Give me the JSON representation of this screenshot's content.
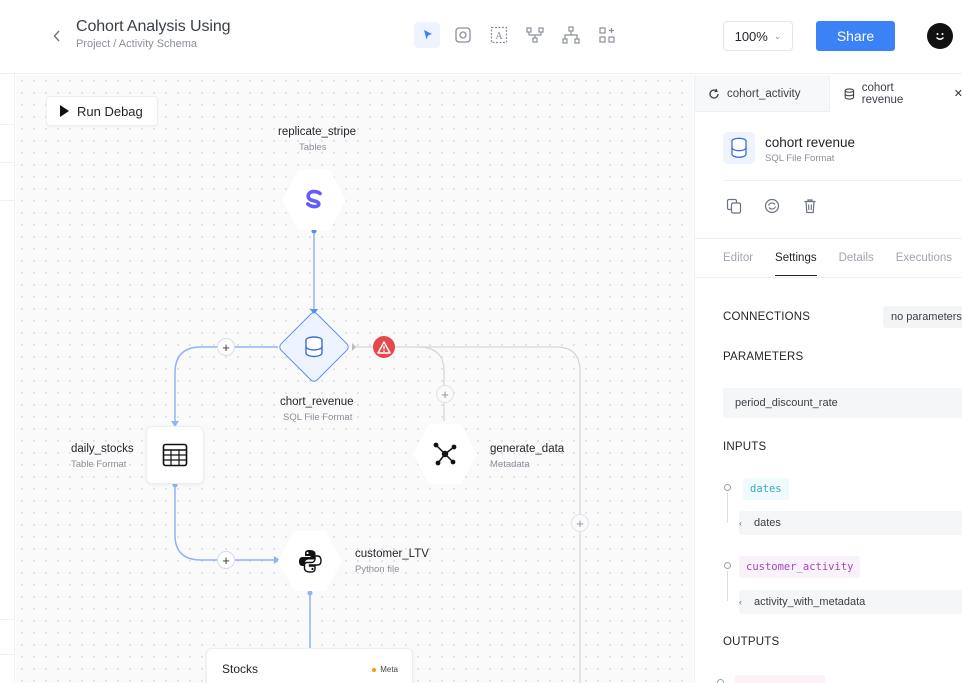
{
  "header": {
    "title": "Cohort Analysis Using",
    "breadcrumb": "Project / Activity Schema",
    "zoom": "100%",
    "share_label": "Share",
    "tools": [
      "cursor-icon",
      "note-icon",
      "text-box-icon",
      "flow-icon",
      "hierarchy-icon",
      "add-component-icon"
    ]
  },
  "canvas": {
    "run_debug_label": "Run Debag",
    "nodes": {
      "replicate": {
        "label": "replicate_stripe",
        "sub": "Tables"
      },
      "chort": {
        "label": "chort_revenue",
        "sub": "SQL File Format"
      },
      "daily": {
        "label": "daily_stocks",
        "sub": "Table Format"
      },
      "generate": {
        "label": "generate_data",
        "sub": "Metadata"
      },
      "customer": {
        "label": "customer_LTV",
        "sub": "Python file"
      }
    },
    "stocks_card": {
      "title": "Stocks",
      "meta": "Meta"
    },
    "colors": {
      "edge": "#8fb3f5",
      "warning": "#e5484d",
      "stripe": "#635bff",
      "accent": "#3b82f6"
    }
  },
  "panel": {
    "tabs": [
      {
        "label": "cohort_activity",
        "icon": "refresh-icon"
      },
      {
        "label": "cohort revenue",
        "icon": "database-icon"
      }
    ],
    "file": {
      "name": "cohort revenue",
      "type": "SQL File Format"
    },
    "sub_tabs": [
      "Editor",
      "Settings",
      "Details",
      "Executions"
    ],
    "active_sub_tab": "Settings",
    "connections": {
      "title": "CONNECTIONS",
      "value": "no parameters"
    },
    "parameters": {
      "title": "PARAMETERS",
      "value": "period_discount_rate"
    },
    "inputs": {
      "title": "INPUTS",
      "items": [
        {
          "tag": "dates",
          "value": "dates"
        },
        {
          "tag": "customer_activity",
          "value": "activity_with_metadata"
        }
      ]
    },
    "outputs": {
      "title": "OUTPUTS"
    }
  }
}
